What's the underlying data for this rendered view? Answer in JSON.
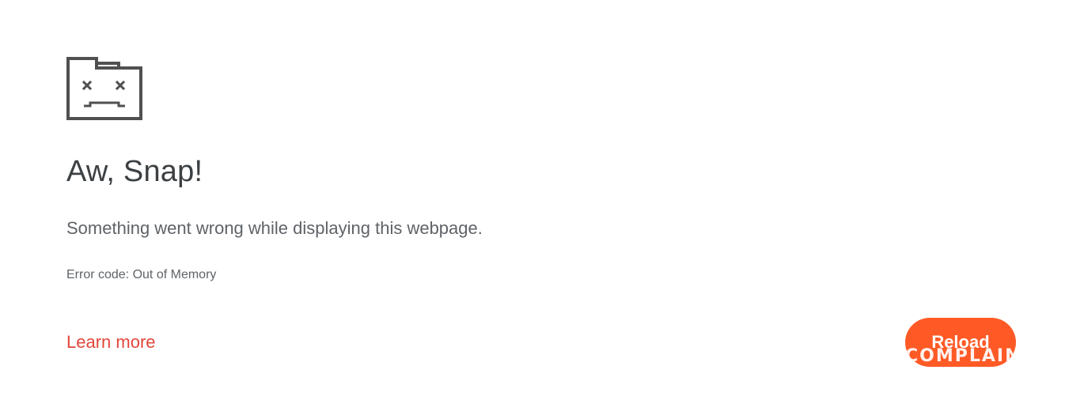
{
  "error_page": {
    "title": "Aw, Snap!",
    "message": "Something went wrong while displaying this webpage.",
    "error_code": "Error code: Out of Memory",
    "learn_more": "Learn more",
    "reload_label": "Reload",
    "watermark": "COMPLAINT",
    "icon": "sad-tab-icon"
  },
  "colors": {
    "title": "#3c4043",
    "text": "#5f6368",
    "link": "#e2463c",
    "button": "#ff5a26",
    "icon": "#505050"
  }
}
